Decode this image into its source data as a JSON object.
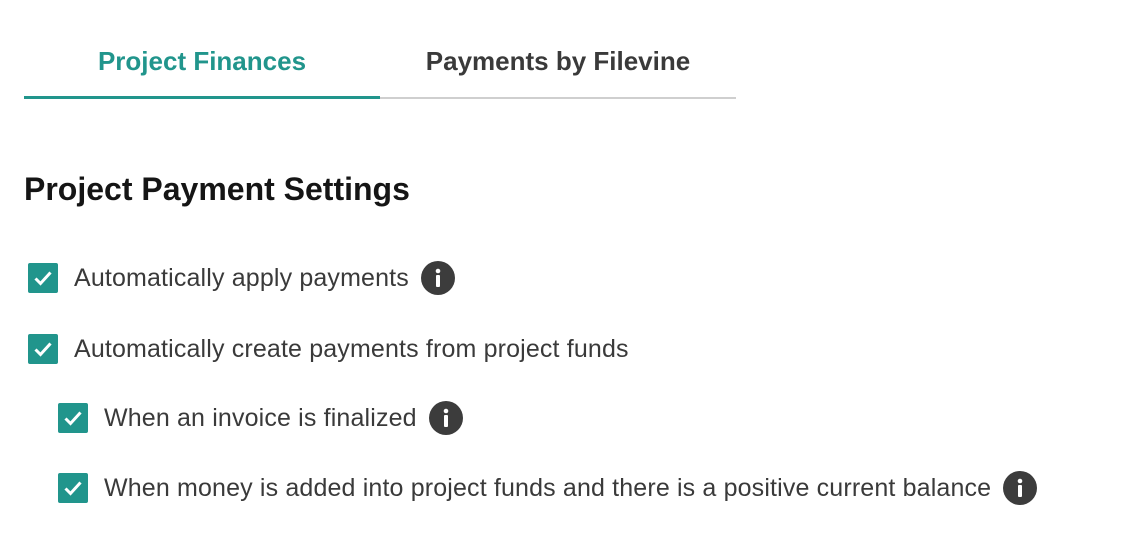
{
  "tabs": [
    {
      "label": "Project Finances",
      "active": true
    },
    {
      "label": "Payments by Filevine",
      "active": false
    }
  ],
  "section": {
    "title": "Project Payment Settings"
  },
  "options": [
    {
      "label": "Automatically apply payments",
      "checked": true,
      "info_icon": "info-icon"
    },
    {
      "label": "Automatically create payments from project funds",
      "checked": true
    },
    {
      "label": "When an invoice is finalized",
      "checked": true,
      "info_icon": "info-icon"
    },
    {
      "label": "When money is added into project funds and there is a positive current balance",
      "checked": true,
      "info_icon": "info-icon"
    }
  ],
  "colors": {
    "accent": "#21958c",
    "text": "#3a3a3a",
    "heading": "#151515",
    "info_icon": "#3c3c3c"
  }
}
